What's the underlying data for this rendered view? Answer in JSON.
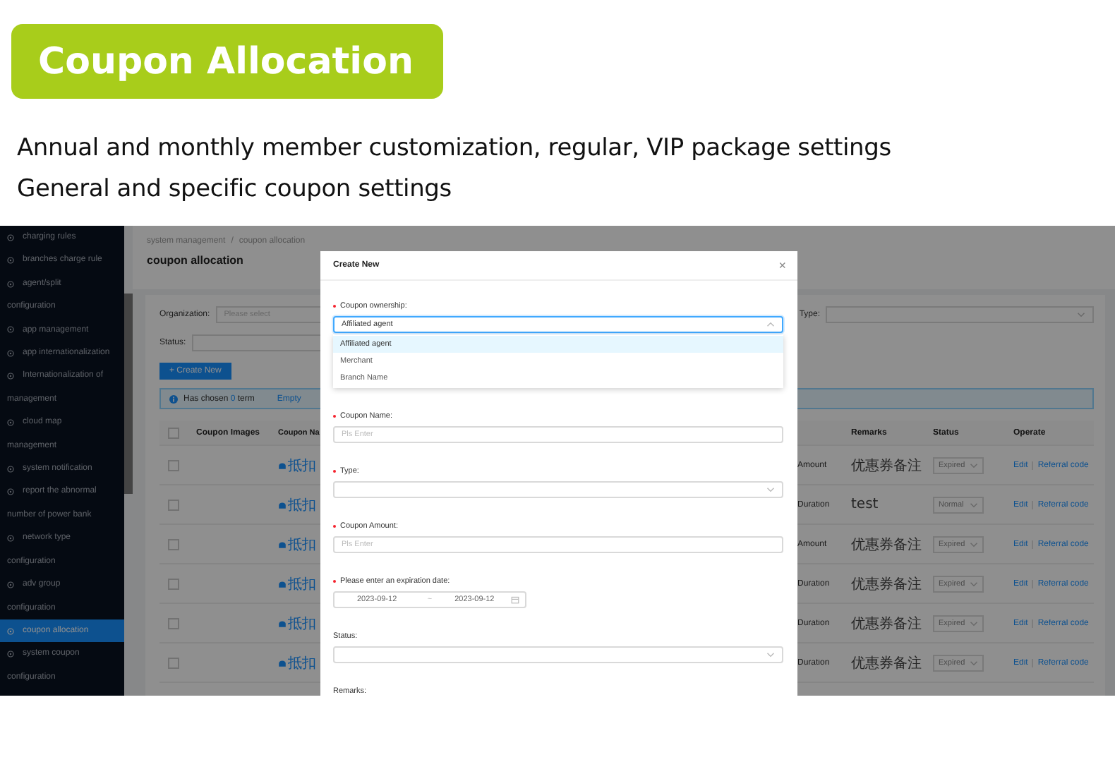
{
  "banner": {
    "title": "Coupon Allocation"
  },
  "subtitles": [
    "Annual and monthly member customization, regular, VIP package settings",
    "General and specific coupon settings"
  ],
  "sidebar": {
    "items": [
      {
        "lines": [
          "charging rules"
        ],
        "selected": false
      },
      {
        "lines": [
          "branches charge rule"
        ],
        "selected": false
      },
      {
        "lines": [
          "agent/split",
          "configuration"
        ],
        "selected": false
      },
      {
        "lines": [
          "app management"
        ],
        "selected": false
      },
      {
        "lines": [
          "app internationalization"
        ],
        "selected": false
      },
      {
        "lines": [
          "Internationalization of",
          "management"
        ],
        "selected": false
      },
      {
        "lines": [
          "cloud map",
          "management"
        ],
        "selected": false
      },
      {
        "lines": [
          "system notification"
        ],
        "selected": false
      },
      {
        "lines": [
          "report the abnormal",
          "number of power bank"
        ],
        "selected": false
      },
      {
        "lines": [
          "network type",
          "configuration"
        ],
        "selected": false
      },
      {
        "lines": [
          "adv group",
          "configuration"
        ],
        "selected": false
      },
      {
        "lines": [
          "coupon allocation"
        ],
        "selected": true
      },
      {
        "lines": [
          "system coupon",
          "configuration"
        ],
        "selected": false
      }
    ]
  },
  "breadcrumb": {
    "items": [
      "system management",
      "coupon allocation"
    ],
    "separator": "/"
  },
  "page_title": "coupon allocation",
  "filters": {
    "organization": {
      "label": "Organization:",
      "placeholder": "Please select"
    },
    "type": {
      "label": "Type:"
    },
    "status": {
      "label": "Status:"
    }
  },
  "create_button": {
    "label": "+ Create New"
  },
  "selection_bar": {
    "prefix": "Has chosen",
    "count": "0",
    "suffix": "term",
    "action": "Empty"
  },
  "table": {
    "all_checked": false,
    "columns": {
      "images": "Coupon Images",
      "name": "Coupon Na",
      "remarks": "Remarks",
      "status": "Status",
      "operate": "Operate"
    },
    "rows": [
      {
        "checked": false,
        "name": "抵扣",
        "column_4": "Amount",
        "remarks": "优惠券备注",
        "status": "Expired",
        "actions": [
          "Edit",
          "Referral code"
        ]
      },
      {
        "checked": false,
        "name": "抵扣",
        "column_4": "Duration",
        "remarks": "test",
        "status": "Normal",
        "actions": [
          "Edit",
          "Referral code"
        ]
      },
      {
        "checked": false,
        "name": "抵扣",
        "column_4": "Amount",
        "remarks": "优惠券备注",
        "status": "Expired",
        "actions": [
          "Edit",
          "Referral code"
        ]
      },
      {
        "checked": false,
        "name": "抵扣",
        "column_4": "Duration",
        "remarks": "优惠券备注",
        "status": "Expired",
        "actions": [
          "Edit",
          "Referral code"
        ]
      },
      {
        "checked": false,
        "name": "抵扣",
        "column_4": "Duration",
        "remarks": "优惠券备注",
        "status": "Expired",
        "actions": [
          "Edit",
          "Referral code"
        ]
      },
      {
        "checked": false,
        "name": "抵扣",
        "column_4": "Duration",
        "remarks": "优惠券备注",
        "status": "Expired",
        "actions": [
          "Edit",
          "Referral code"
        ]
      }
    ]
  },
  "modal": {
    "title": "Create New",
    "close": "×",
    "fields": [
      {
        "kind": "select",
        "label": "Coupon ownership:",
        "required": true,
        "value": "Affiliated agent",
        "expanded": true,
        "options": [
          {
            "label": "Affiliated agent",
            "selected": true
          },
          {
            "label": "Merchant",
            "selected": false
          },
          {
            "label": "Branch Name",
            "selected": false
          }
        ]
      },
      {
        "kind": "input",
        "label": "Coupon Name:",
        "required": true,
        "placeholder": "Pls Enter"
      },
      {
        "kind": "select",
        "label": "Type:",
        "required": true,
        "expanded": false
      },
      {
        "kind": "input",
        "label": "Coupon Amount:",
        "required": true,
        "placeholder": "Pls Enter"
      },
      {
        "kind": "date_range",
        "label": "Please enter an expiration date:",
        "required": true,
        "start": "2023-09-12",
        "separator": "~",
        "end": "2023-09-12"
      },
      {
        "kind": "select",
        "label": "Status:",
        "required": false,
        "expanded": false
      },
      {
        "kind": "label",
        "label": "Remarks:",
        "required": false
      }
    ]
  }
}
